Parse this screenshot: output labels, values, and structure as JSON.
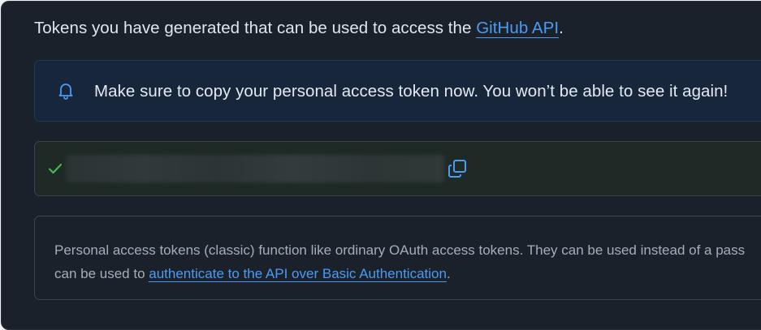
{
  "intro": {
    "text": "Tokens you have generated that can be used to access the ",
    "link": "GitHub API",
    "suffix": "."
  },
  "notice": {
    "icon": "bell-icon",
    "message": "Make sure to copy your personal access token now. You won’t be able to see it again!"
  },
  "token": {
    "status_icon": "check-icon",
    "copy_icon": "copy-icon",
    "status_color": "#3fb950"
  },
  "info": {
    "line1": "Personal access tokens (classic) function like ordinary OAuth access tokens. They can be used instead of a pass",
    "line2_prefix": "can be used to ",
    "link": "authenticate to the API over Basic Authentication",
    "line2_suffix": "."
  },
  "colors": {
    "background": "#1b212b",
    "link": "#4b9bf5",
    "notice_bg": "#17263a",
    "token_bg": "#1f2a26"
  }
}
